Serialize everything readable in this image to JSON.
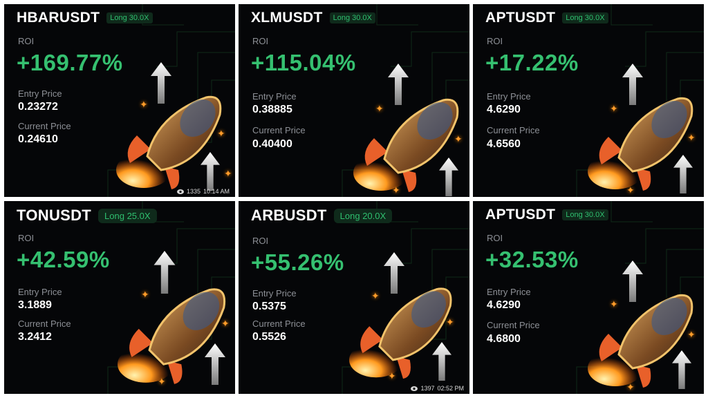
{
  "cards": [
    {
      "pair": "HBARUSDT",
      "badge": "Long 30.0X",
      "roi_label": "ROI",
      "roi": "+169.77%",
      "entry_label": "Entry Price",
      "entry": "0.23272",
      "current_label": "Current Price",
      "current": "0.24610",
      "views": "1335",
      "time": "10:14 AM"
    },
    {
      "pair": "XLMUSDT",
      "badge": "Long 30.0X",
      "roi_label": "ROI",
      "roi": "+115.04%",
      "entry_label": "Entry Price",
      "entry": "0.38885",
      "current_label": "Current Price",
      "current": "0.40400"
    },
    {
      "pair": "APTUSDT",
      "badge": "Long 30.0X",
      "roi_label": "ROI",
      "roi": "+17.22%",
      "entry_label": "Entry Price",
      "entry": "4.6290",
      "current_label": "Current Price",
      "current": "4.6560"
    },
    {
      "pair": "TONUSDT",
      "badge": "Long 25.0X",
      "roi_label": "ROI",
      "roi": "+42.59%",
      "entry_label": "Entry Price",
      "entry": "3.1889",
      "current_label": "Current Price",
      "current": "3.2412"
    },
    {
      "pair": "ARBUSDT",
      "badge": "Long 20.0X",
      "roi_label": "ROI",
      "roi": "+55.26%",
      "entry_label": "Entry Price",
      "entry": "0.5375",
      "current_label": "Current Price",
      "current": "0.5526",
      "views": "1397",
      "time": "02:52 PM"
    },
    {
      "pair": "APTUSDT",
      "badge": "Long 30.0X",
      "roi_label": "ROI",
      "roi": "+32.53%",
      "entry_label": "Entry Price",
      "entry": "4.6290",
      "current_label": "Current Price",
      "current": "4.6800"
    }
  ],
  "colors": {
    "background": "#050608",
    "profit_green": "#35c070",
    "badge_green": "#2fbf6f",
    "label_gray": "#8d9096",
    "spark_orange": "#ff9c2a"
  },
  "icons": [
    "rocket-illustration",
    "up-arrow-icon",
    "sparkle-icon",
    "eye-icon"
  ]
}
